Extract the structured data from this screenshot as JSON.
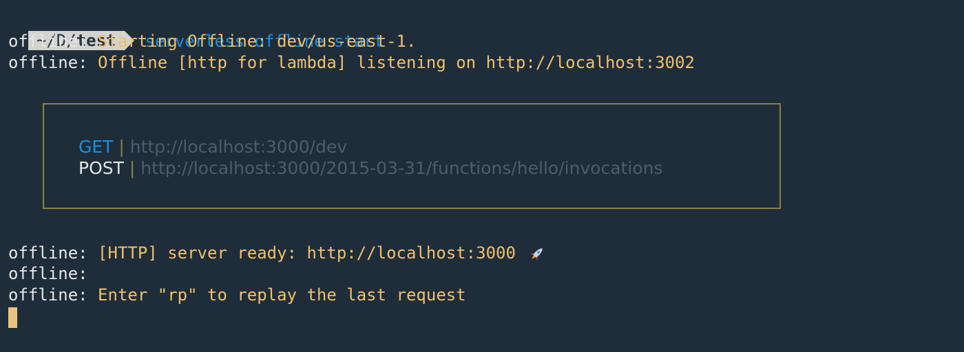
{
  "prompt": {
    "dir_prefix": "~/D/",
    "dir_name": "test",
    "command": "serverless offline start"
  },
  "output_top": [
    {
      "label": "offline:",
      "message": "Starting Offline: dev/us-east-1."
    },
    {
      "label": "offline:",
      "message": "Offline [http for lambda] listening on http://localhost:3002"
    }
  ],
  "routes": [
    {
      "method": "GET",
      "separator": "|",
      "url": "http://localhost:3000/dev"
    },
    {
      "method": "POST",
      "separator": "|",
      "url": "http://localhost:3000/2015-03-31/functions/hello/invocations"
    }
  ],
  "output_bottom": [
    {
      "label": "offline:",
      "message": "[HTTP] server ready: http://localhost:3000",
      "icon": "rocket-icon"
    },
    {
      "label": "offline:",
      "message": ""
    },
    {
      "label": "offline:",
      "message": "Enter \"rp\" to replay the last request"
    }
  ],
  "colors": {
    "background": "#1f2d3a",
    "command": "#1a8fe3",
    "message": "#f0c06a",
    "box_border": "#8a8240",
    "url": "#505c66",
    "cursor": "#e9c57b"
  }
}
